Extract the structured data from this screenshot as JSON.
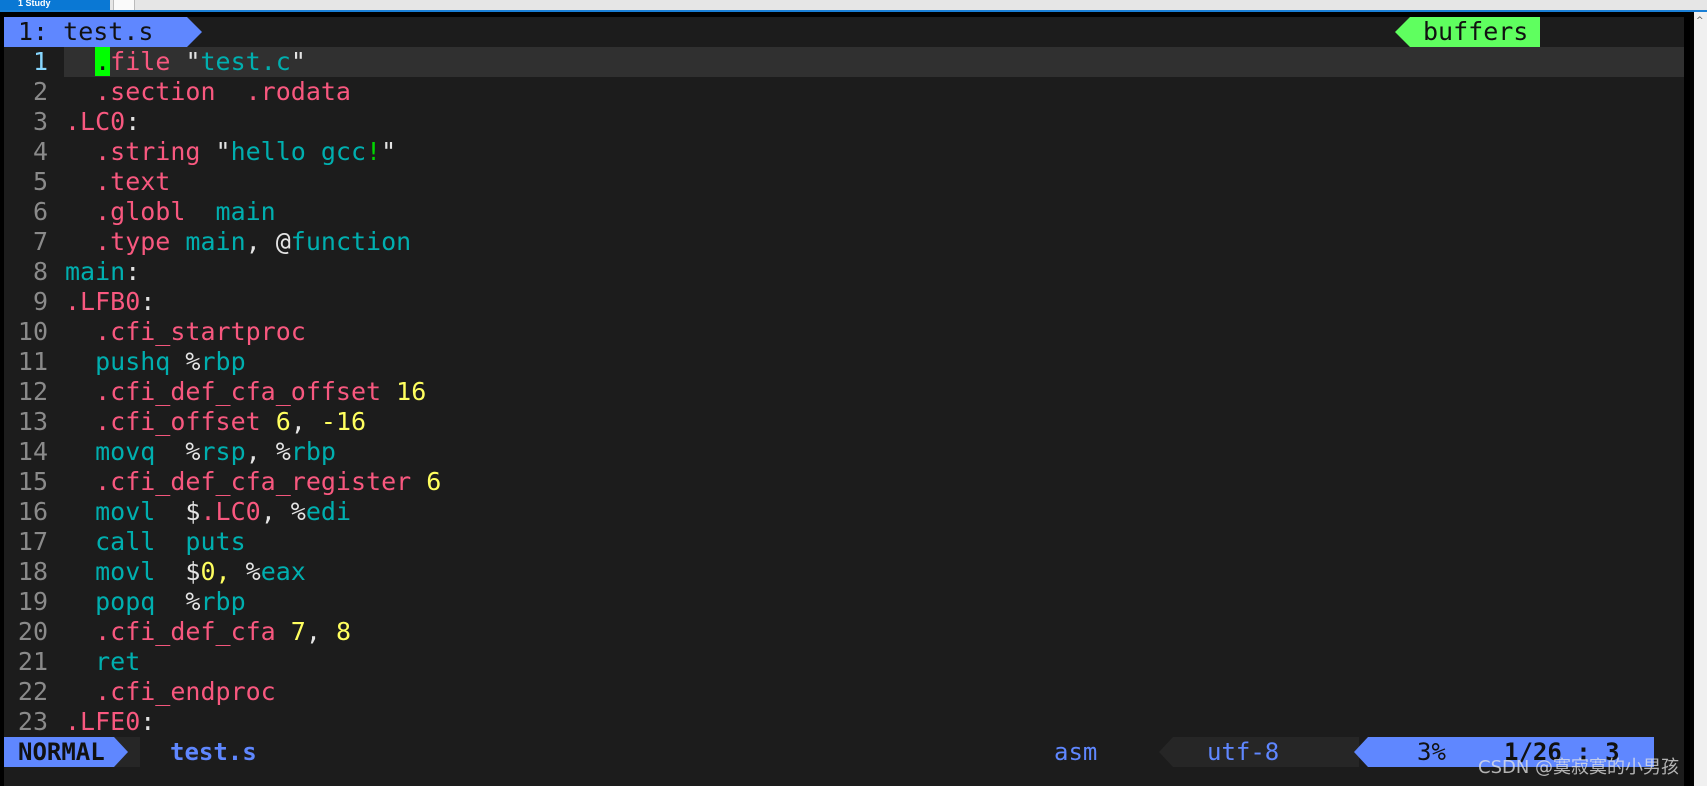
{
  "window": {
    "tab_label": "1 Study"
  },
  "tabline": {
    "active_tab": "1: test.s",
    "right_label": "buffers"
  },
  "colors": {
    "pink": "#f8587f",
    "teal": "#00afaf",
    "white": "#e4e4e4",
    "yellow": "#ffff5f",
    "green": "#00d700",
    "accent_blue": "#5f87ff",
    "buffers_green": "#5fff5f"
  },
  "editor": {
    "current_line": 1,
    "lines": [
      [
        [
          "  ",
          "w"
        ],
        [
          ".",
          "cursor"
        ],
        [
          "file ",
          "p"
        ],
        [
          "\"",
          "w"
        ],
        [
          "test.c",
          "t"
        ],
        [
          "\"",
          "w"
        ]
      ],
      [
        [
          "  .section  .rodata",
          "p"
        ]
      ],
      [
        [
          ".LC0",
          "p"
        ],
        [
          ":",
          "w"
        ]
      ],
      [
        [
          "  .string ",
          "p"
        ],
        [
          "\"",
          "w"
        ],
        [
          "hello gcc",
          "t"
        ],
        [
          "!",
          "g"
        ],
        [
          "\"",
          "w"
        ]
      ],
      [
        [
          "  .text",
          "p"
        ]
      ],
      [
        [
          "  .globl  ",
          "p"
        ],
        [
          "main",
          "t"
        ]
      ],
      [
        [
          "  .type ",
          "p"
        ],
        [
          "main",
          "t"
        ],
        [
          ", @",
          "w"
        ],
        [
          "function",
          "t"
        ]
      ],
      [
        [
          "main",
          "t"
        ],
        [
          ":",
          "w"
        ]
      ],
      [
        [
          ".LFB0",
          "p"
        ],
        [
          ":",
          "w"
        ]
      ],
      [
        [
          "  .cfi_startproc",
          "p"
        ]
      ],
      [
        [
          "  pushq ",
          "t"
        ],
        [
          "%",
          "w"
        ],
        [
          "rbp",
          "t"
        ]
      ],
      [
        [
          "  .cfi_def_cfa_offset ",
          "p"
        ],
        [
          "16",
          "y"
        ]
      ],
      [
        [
          "  .cfi_offset ",
          "p"
        ],
        [
          "6",
          "y"
        ],
        [
          ", ",
          "w"
        ],
        [
          "-16",
          "y"
        ]
      ],
      [
        [
          "  movq  ",
          "t"
        ],
        [
          "%",
          "w"
        ],
        [
          "rsp",
          "t"
        ],
        [
          ", %",
          "w"
        ],
        [
          "rbp",
          "t"
        ]
      ],
      [
        [
          "  .cfi_def_cfa_register ",
          "p"
        ],
        [
          "6",
          "y"
        ]
      ],
      [
        [
          "  movl  ",
          "t"
        ],
        [
          "$",
          "w"
        ],
        [
          ".LC0",
          "p"
        ],
        [
          ", %",
          "w"
        ],
        [
          "edi",
          "t"
        ]
      ],
      [
        [
          "  call  puts",
          "t"
        ]
      ],
      [
        [
          "  movl  ",
          "t"
        ],
        [
          "$",
          "w"
        ],
        [
          "0,",
          "y"
        ],
        [
          " %",
          "w"
        ],
        [
          "eax",
          "t"
        ]
      ],
      [
        [
          "  popq  ",
          "t"
        ],
        [
          "%",
          "w"
        ],
        [
          "rbp",
          "t"
        ]
      ],
      [
        [
          "  .cfi_def_cfa ",
          "p"
        ],
        [
          "7",
          "y"
        ],
        [
          ", ",
          "w"
        ],
        [
          "8",
          "y"
        ]
      ],
      [
        [
          "  ret",
          "t"
        ]
      ],
      [
        [
          "  .cfi_endproc",
          "p"
        ]
      ],
      [
        [
          ".LFE0",
          "p"
        ],
        [
          ":",
          "w"
        ]
      ]
    ]
  },
  "statusbar": {
    "mode": "NORMAL",
    "filename": "test.s",
    "filetype": "asm",
    "encoding": "utf-8",
    "percent": "3%",
    "position": "1/26 :  3"
  },
  "watermark": "CSDN @寞寂寞的小男孩"
}
